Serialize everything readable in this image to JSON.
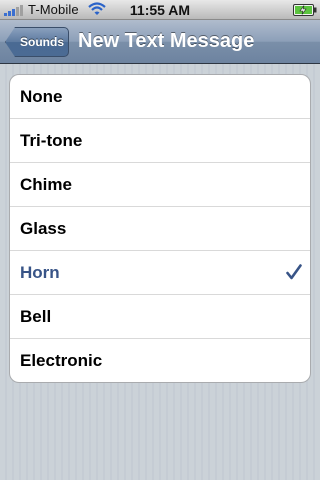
{
  "status_bar": {
    "carrier": "T-Mobile",
    "time": "11:55 AM",
    "signal_icon": "signal-bars-icon",
    "wifi_icon": "wifi-icon",
    "battery_icon": "battery-charging-icon"
  },
  "nav_bar": {
    "back_label": "Sounds",
    "title": "New Text Message"
  },
  "list": {
    "items": [
      {
        "label": "None",
        "selected": false
      },
      {
        "label": "Tri-tone",
        "selected": false
      },
      {
        "label": "Chime",
        "selected": false
      },
      {
        "label": "Glass",
        "selected": false
      },
      {
        "label": "Horn",
        "selected": true
      },
      {
        "label": "Bell",
        "selected": false
      },
      {
        "label": "Electronic",
        "selected": false
      }
    ],
    "check_icon": "checkmark-icon",
    "selected_color": "#385487"
  }
}
